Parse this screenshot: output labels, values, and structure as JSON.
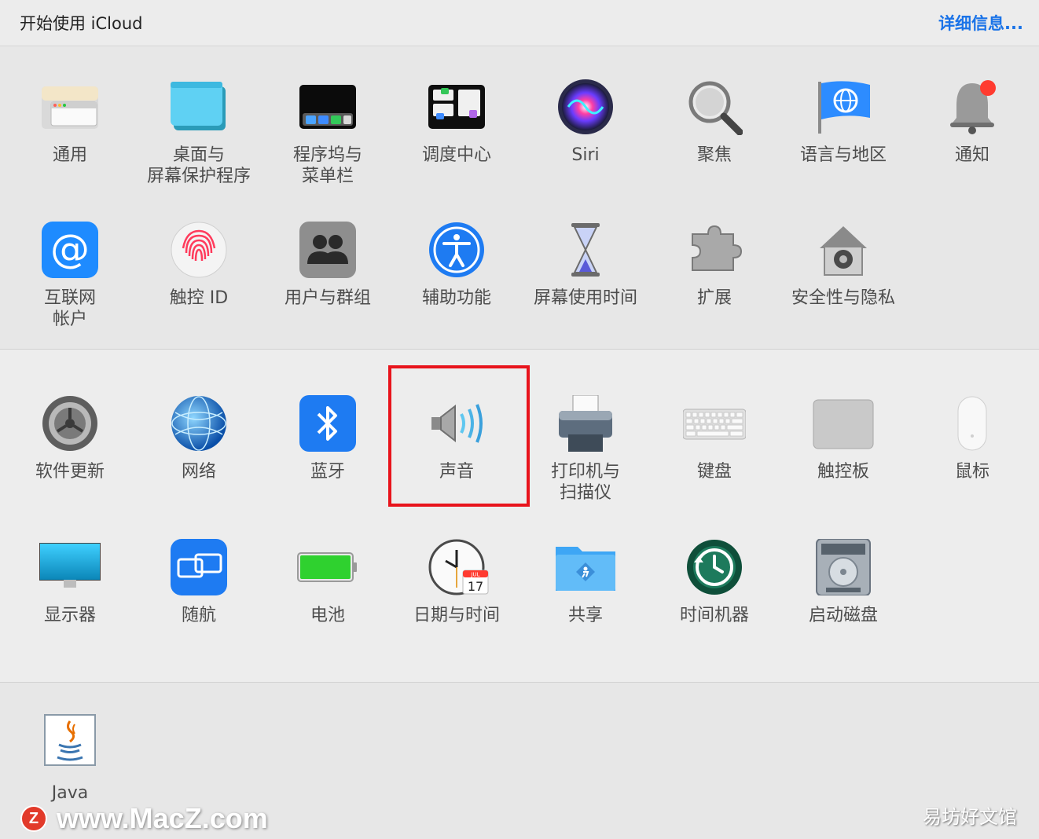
{
  "header": {
    "title": "开始使用 iCloud",
    "details_link": "详细信息..."
  },
  "section1": {
    "row1": [
      {
        "label": "通用",
        "icon": "general-icon"
      },
      {
        "label": "桌面与\n屏幕保护程序",
        "icon": "desktop-screensaver-icon"
      },
      {
        "label": "程序坞与\n菜单栏",
        "icon": "dock-menubar-icon"
      },
      {
        "label": "调度中心",
        "icon": "mission-control-icon"
      },
      {
        "label": "Siri",
        "icon": "siri-icon"
      },
      {
        "label": "聚焦",
        "icon": "spotlight-icon"
      },
      {
        "label": "语言与地区",
        "icon": "language-region-icon"
      },
      {
        "label": "通知",
        "icon": "notifications-icon"
      }
    ],
    "row2": [
      {
        "label": "互联网\n帐户",
        "icon": "internet-accounts-icon"
      },
      {
        "label": "触控 ID",
        "icon": "touch-id-icon"
      },
      {
        "label": "用户与群组",
        "icon": "users-groups-icon"
      },
      {
        "label": "辅助功能",
        "icon": "accessibility-icon"
      },
      {
        "label": "屏幕使用时间",
        "icon": "screen-time-icon"
      },
      {
        "label": "扩展",
        "icon": "extensions-icon"
      },
      {
        "label": "安全性与隐私",
        "icon": "security-privacy-icon"
      }
    ]
  },
  "section2": {
    "row1": [
      {
        "label": "软件更新",
        "icon": "software-update-icon"
      },
      {
        "label": "网络",
        "icon": "network-icon"
      },
      {
        "label": "蓝牙",
        "icon": "bluetooth-icon"
      },
      {
        "label": "声音",
        "icon": "sound-icon"
      },
      {
        "label": "打印机与\n扫描仪",
        "icon": "printers-scanners-icon"
      },
      {
        "label": "键盘",
        "icon": "keyboard-icon"
      },
      {
        "label": "触控板",
        "icon": "trackpad-icon"
      },
      {
        "label": "鼠标",
        "icon": "mouse-icon"
      }
    ],
    "row2": [
      {
        "label": "显示器",
        "icon": "displays-icon"
      },
      {
        "label": "随航",
        "icon": "sidecar-icon"
      },
      {
        "label": "电池",
        "icon": "battery-icon"
      },
      {
        "label": "日期与时间",
        "icon": "date-time-icon"
      },
      {
        "label": "共享",
        "icon": "sharing-icon"
      },
      {
        "label": "时间机器",
        "icon": "time-machine-icon"
      },
      {
        "label": "启动磁盘",
        "icon": "startup-disk-icon"
      }
    ]
  },
  "section3": {
    "row1": [
      {
        "label": "Java",
        "icon": "java-icon"
      }
    ]
  },
  "calendar_icon": {
    "month": "JUL",
    "day": "17"
  },
  "watermark": {
    "left_logo": "Z",
    "left_url": "www.MacZ.com",
    "right_text": "易坊好文馆"
  },
  "colors": {
    "accent": "#1a73e8",
    "highlight": "#e8141c"
  }
}
